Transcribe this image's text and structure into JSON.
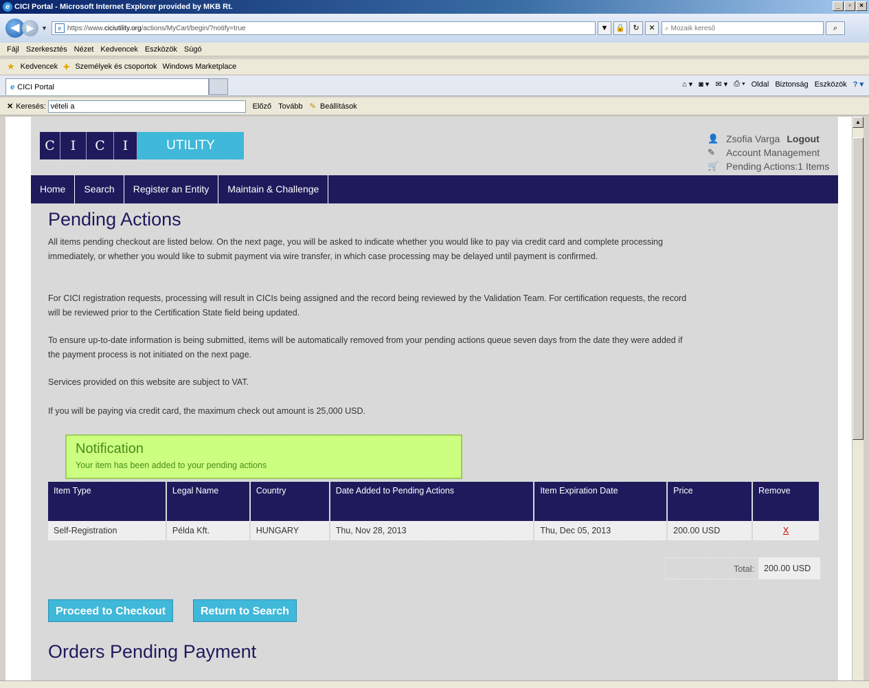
{
  "window": {
    "title": "CICI Portal - Microsoft Internet Explorer provided by MKB Rt."
  },
  "address": {
    "prefix": "https://www.",
    "domain": "ciciutility.org",
    "path": "/actions/MyCart/begin/?notify=true"
  },
  "search": {
    "placeholder": "Mozaik kereső"
  },
  "menu": [
    "Fájl",
    "Szerkesztés",
    "Nézet",
    "Kedvencek",
    "Eszközök",
    "Súgó"
  ],
  "favorites": {
    "label": "Kedvencek",
    "items": [
      "Személyek és csoportok",
      "Windows Marketplace"
    ]
  },
  "tab": {
    "title": "CICI Portal"
  },
  "commands": [
    "Oldal",
    "Biztonság",
    "Eszközök"
  ],
  "find": {
    "label": "Keresés:",
    "value": "vételi a",
    "prev": "Előző",
    "next": "Tovább",
    "options": "Beállítások"
  },
  "logo": {
    "letters": [
      "C",
      "I",
      "C",
      "I"
    ],
    "suffix": "UTILITY"
  },
  "user": {
    "name": "Zsofia Varga",
    "logout": "Logout",
    "account": "Account Management",
    "pending": "Pending Actions:1 Items"
  },
  "nav": [
    "Home",
    "Search",
    "Register an Entity",
    "Maintain & Challenge"
  ],
  "content": {
    "title": "Pending Actions",
    "p1": "All items pending checkout are listed below. On the next page, you will be asked to indicate whether you would like to pay via credit card and complete processing immediately, or whether you would like to submit payment via wire transfer, in which case processing may be delayed until payment is confirmed.",
    "p2": "For CICI registration requests, processing will result in CICIs being assigned and the record being reviewed by the Validation Team. For certification requests, the record will be reviewed prior to the Certification State field being updated.",
    "p3": "To ensure up-to-date information is being submitted, items will be automatically removed from your pending actions queue seven days from the date they were added if the payment process is not initiated on the next page.",
    "p4": "Services provided on this website are subject to VAT.",
    "p5": "If you will be paying via credit card, the maximum check out amount is 25,000 USD."
  },
  "notification": {
    "title": "Notification",
    "message": "Your item has been added to your pending actions"
  },
  "table": {
    "headers": [
      "Item Type",
      "Legal Name",
      "Country",
      "Date Added to Pending Actions",
      "Item Expiration Date",
      "Price",
      "Remove"
    ],
    "rows": [
      {
        "type": "Self-Registration",
        "name": "Példa Kft.",
        "country": "HUNGARY",
        "added": "Thu, Nov 28, 2013",
        "expires": "Thu, Dec 05, 2013",
        "price": "200.00 USD",
        "remove": "X"
      }
    ]
  },
  "total": {
    "label": "Total:",
    "value": "200.00 USD"
  },
  "buttons": {
    "checkout": "Proceed to Checkout",
    "return": "Return to Search"
  },
  "orders": {
    "title": "Orders Pending Payment"
  }
}
